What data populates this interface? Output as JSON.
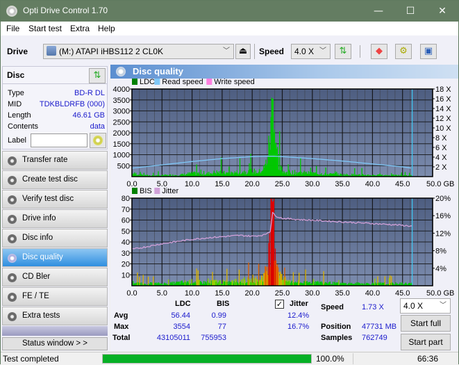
{
  "window": {
    "title": "Opti Drive Control 1.70",
    "minimize": "—",
    "maximize": "☐",
    "close": "✕"
  },
  "menu": [
    "File",
    "Start test",
    "Extra",
    "Help"
  ],
  "toolbar": {
    "drive_label": "Drive",
    "drive_value": "(M:)  ATAPI iHBS112  2 CL0K",
    "speed_label": "Speed",
    "speed_value": "4.0 X"
  },
  "disc": {
    "header": "Disc",
    "type_label": "Type",
    "type_value": "BD-R DL",
    "mid_label": "MID",
    "mid_value": "TDKBLDRFB (000)",
    "length_label": "Length",
    "length_value": "46.61 GB",
    "contents_label": "Contents",
    "contents_value": "data",
    "label_label": "Label",
    "label_value": ""
  },
  "nav": [
    {
      "label": "Transfer rate",
      "active": false
    },
    {
      "label": "Create test disc",
      "active": false
    },
    {
      "label": "Verify test disc",
      "active": false
    },
    {
      "label": "Drive info",
      "active": false
    },
    {
      "label": "Disc info",
      "active": false
    },
    {
      "label": "Disc quality",
      "active": true
    },
    {
      "label": "CD Bler",
      "active": false
    },
    {
      "label": "FE / TE",
      "active": false
    },
    {
      "label": "Extra tests",
      "active": false
    }
  ],
  "status_window_button": "Status window > >",
  "panel_title": "Disc quality",
  "colors": {
    "ldc": "#00c000",
    "bis": "#00c000",
    "read_speed": "#7fc8f8",
    "write_speed": "#ff80e0",
    "jitter": "#d0a0d8",
    "plot_bg_top": "#4d5d80",
    "plot_bg_bottom": "#7c8cae",
    "accent": "#2f8fe0"
  },
  "chart_data": [
    {
      "type": "bar",
      "title": "LDC / Read speed",
      "legend": [
        "LDC",
        "Read speed",
        "Write speed"
      ],
      "legend_position": "top-left",
      "xlabel": "GB",
      "xlim": [
        0,
        50
      ],
      "x_ticks": [
        "0.0",
        "5.0",
        "10.0",
        "15.0",
        "20.0",
        "25.0",
        "30.0",
        "35.0",
        "40.0",
        "45.0",
        "50.0 GB"
      ],
      "ylim": [
        0,
        4000
      ],
      "y_ticks": [
        "4000",
        "3500",
        "3000",
        "2500",
        "2000",
        "1500",
        "1000",
        "500"
      ],
      "y2lim": [
        0,
        18
      ],
      "y2_ticks": [
        "18 X",
        "16 X",
        "14 X",
        "12 X",
        "10 X",
        "8 X",
        "6 X",
        "4 X",
        "2 X"
      ],
      "grid": true,
      "end_marker_gb": 46.61,
      "series": [
        {
          "name": "LDC",
          "x": [
            0,
            2,
            4,
            6,
            8,
            10,
            12,
            14,
            16,
            18,
            20,
            21,
            22,
            22.5,
            23,
            23.3,
            23.6,
            24,
            24.5,
            25,
            26,
            28,
            30,
            32,
            34,
            36,
            38,
            40,
            42,
            44,
            46.6
          ],
          "values": [
            150,
            60,
            50,
            70,
            80,
            150,
            120,
            200,
            150,
            220,
            250,
            200,
            400,
            900,
            2000,
            3554,
            2400,
            1200,
            400,
            250,
            200,
            180,
            150,
            120,
            100,
            90,
            80,
            70,
            60,
            60,
            50
          ]
        },
        {
          "name": "Read speed",
          "x": [
            0,
            5,
            10,
            15,
            20,
            23.3,
            25,
            30,
            35,
            40,
            45,
            46.6
          ],
          "values": [
            1.73,
            2.4,
            3.1,
            3.7,
            4.1,
            4.2,
            4.1,
            3.7,
            3.2,
            2.6,
            2.0,
            1.73
          ]
        }
      ]
    },
    {
      "type": "bar",
      "title": "BIS / Jitter",
      "legend": [
        "BIS",
        "Jitter"
      ],
      "legend_position": "top-left",
      "xlabel": "GB",
      "xlim": [
        0,
        50
      ],
      "x_ticks": [
        "0.0",
        "5.0",
        "10.0",
        "15.0",
        "20.0",
        "25.0",
        "30.0",
        "35.0",
        "40.0",
        "45.0",
        "50.0 GB"
      ],
      "ylim": [
        0,
        80
      ],
      "y_ticks": [
        "80",
        "70",
        "60",
        "50",
        "40",
        "30",
        "20",
        "10"
      ],
      "y2lim": [
        0,
        20
      ],
      "y2_ticks": [
        "20%",
        "16%",
        "12%",
        "8%",
        "4%"
      ],
      "grid": true,
      "end_marker_gb": 46.61,
      "series": [
        {
          "name": "BIS",
          "x": [
            0,
            2,
            4,
            6,
            8,
            10,
            12,
            14,
            16,
            18,
            20,
            21,
            22,
            22.5,
            23,
            23.3,
            23.6,
            24,
            24.5,
            25,
            26,
            28,
            30,
            32,
            34,
            36,
            38,
            40,
            42,
            44,
            46.6
          ],
          "values": [
            3,
            2,
            2,
            2,
            3,
            4,
            3,
            4,
            3,
            5,
            5,
            6,
            10,
            20,
            45,
            77,
            50,
            25,
            12,
            6,
            4,
            3,
            3,
            3,
            2,
            2,
            2,
            2,
            2,
            2,
            2
          ]
        },
        {
          "name": "Jitter",
          "x": [
            0,
            2,
            5,
            8,
            10,
            13,
            16,
            18,
            20,
            22,
            23,
            23.4,
            23.8,
            25,
            28,
            32,
            36,
            40,
            44,
            46.6
          ],
          "values": [
            8.3,
            8.8,
            9.6,
            10.2,
            10.6,
            11.0,
            11.3,
            11.5,
            11.3,
            11.6,
            12.5,
            16.7,
            16.0,
            15.4,
            15.1,
            14.8,
            14.5,
            14.2,
            13.9,
            13.6
          ]
        }
      ]
    }
  ],
  "stats": {
    "col_ldc": "LDC",
    "col_bis": "BIS",
    "avg_label": "Avg",
    "max_label": "Max",
    "total_label": "Total",
    "ldc_avg": "56.44",
    "ldc_max": "3554",
    "ldc_total": "43105011",
    "bis_avg": "0.99",
    "bis_max": "77",
    "bis_total": "755953",
    "jitter_label": "Jitter",
    "jitter_checked": true,
    "jitter_avg": "12.4%",
    "jitter_max": "16.7%",
    "speed_label": "Speed",
    "speed_value": "1.73 X",
    "position_label": "Position",
    "position_value": "47731 MB",
    "samples_label": "Samples",
    "samples_value": "762749",
    "speed_select": "4.0 X",
    "start_full": "Start full",
    "start_part": "Start part"
  },
  "statusbar": {
    "text": "Test completed",
    "progress": 100.0,
    "progress_text": "100.0%",
    "time": "66:36"
  }
}
